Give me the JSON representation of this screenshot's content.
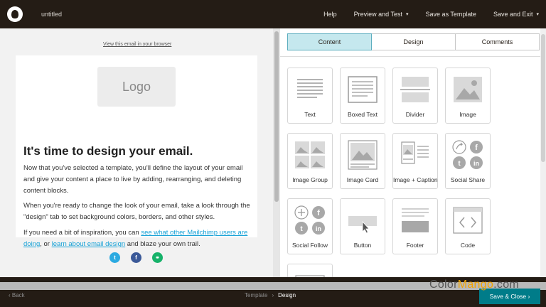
{
  "app": {
    "doc_title": "untitled"
  },
  "topnav": {
    "help": "Help",
    "preview": "Preview and Test",
    "save_template": "Save as Template",
    "save_exit": "Save and Exit",
    "caret": "▾"
  },
  "preview": {
    "view_link": "View this email in your browser",
    "logo_placeholder": "Logo",
    "heading": "It's time to design your email.",
    "p1": "Now that you've selected a template, you'll define the layout of your email and give your content a place to live by adding, rearranging, and deleting content blocks.",
    "p2": "When you're ready to change the look of your email, take a look through the \"design\" tab to set background colors, borders, and other styles.",
    "p3_a": "If you need a bit of inspiration, you can ",
    "p3_link1": "see what other Mailchimp users are doing",
    "p3_b": ", or ",
    "p3_link2": "learn about email design",
    "p3_c": " and blaze your own trail.",
    "social": [
      {
        "name": "twitter-icon",
        "glyph": "t",
        "color": "#2baae1"
      },
      {
        "name": "facebook-icon",
        "glyph": "f",
        "color": "#3b5998"
      },
      {
        "name": "link-icon",
        "glyph": "⚭",
        "color": "#17b26a"
      }
    ]
  },
  "tabs": [
    {
      "label": "Content",
      "active": true
    },
    {
      "label": "Design",
      "active": false
    },
    {
      "label": "Comments",
      "active": false
    }
  ],
  "blocks": [
    {
      "label": "Text",
      "icon": "text-block-icon"
    },
    {
      "label": "Boxed Text",
      "icon": "boxed-text-icon"
    },
    {
      "label": "Divider",
      "icon": "divider-icon"
    },
    {
      "label": "Image",
      "icon": "image-icon"
    },
    {
      "label": "Image Group",
      "icon": "image-group-icon"
    },
    {
      "label": "Image Card",
      "icon": "image-card-icon"
    },
    {
      "label": "Image + Caption",
      "icon": "image-caption-icon"
    },
    {
      "label": "Social Share",
      "icon": "social-share-icon"
    },
    {
      "label": "Social Follow",
      "icon": "social-follow-icon"
    },
    {
      "label": "Button",
      "icon": "button-block-icon"
    },
    {
      "label": "Footer",
      "icon": "footer-icon"
    },
    {
      "label": "Code",
      "icon": "code-icon"
    },
    {
      "label": "",
      "icon": "video-block-icon"
    }
  ],
  "bottombar": {
    "back": "‹ Back",
    "crumb_template": "Template",
    "crumb_chev": "›",
    "crumb_active": "Design",
    "save_close": "Save & Close ›"
  },
  "watermark": {
    "part1": "Color",
    "part2": "Mango",
    "part3": ".com"
  },
  "colors": {
    "brand_dark": "#241c15",
    "accent_teal": "#007c89",
    "tab_active": "#c5e8ee",
    "link": "#16a1d6"
  }
}
